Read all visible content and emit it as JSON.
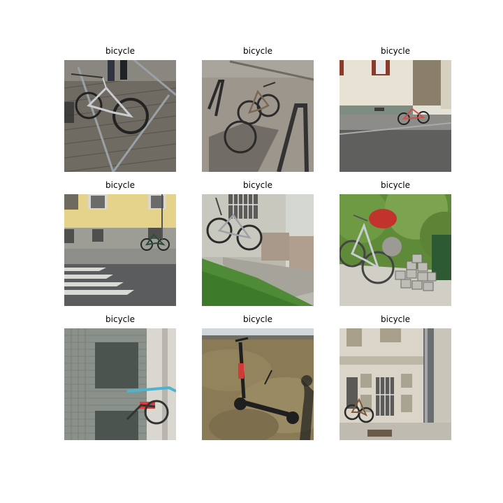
{
  "grid": {
    "rows": 3,
    "cols": 3,
    "items": [
      {
        "label": "bicycle",
        "scene": "bicycle-on-paved-rack"
      },
      {
        "label": "bicycle",
        "scene": "bicycle-at-metal-rack"
      },
      {
        "label": "bicycle",
        "scene": "bicycle-near-building-corner"
      },
      {
        "label": "bicycle",
        "scene": "bicycle-by-yellow-building"
      },
      {
        "label": "bicycle",
        "scene": "bicycle-against-wall-grass"
      },
      {
        "label": "bicycle",
        "scene": "bicycle-with-cobblestones"
      },
      {
        "label": "bicycle",
        "scene": "bicycle-by-tiled-wall"
      },
      {
        "label": "bicycle",
        "scene": "e-scooter-on-lawn"
      },
      {
        "label": "bicycle",
        "scene": "bicycle-by-ornate-facade"
      }
    ]
  }
}
